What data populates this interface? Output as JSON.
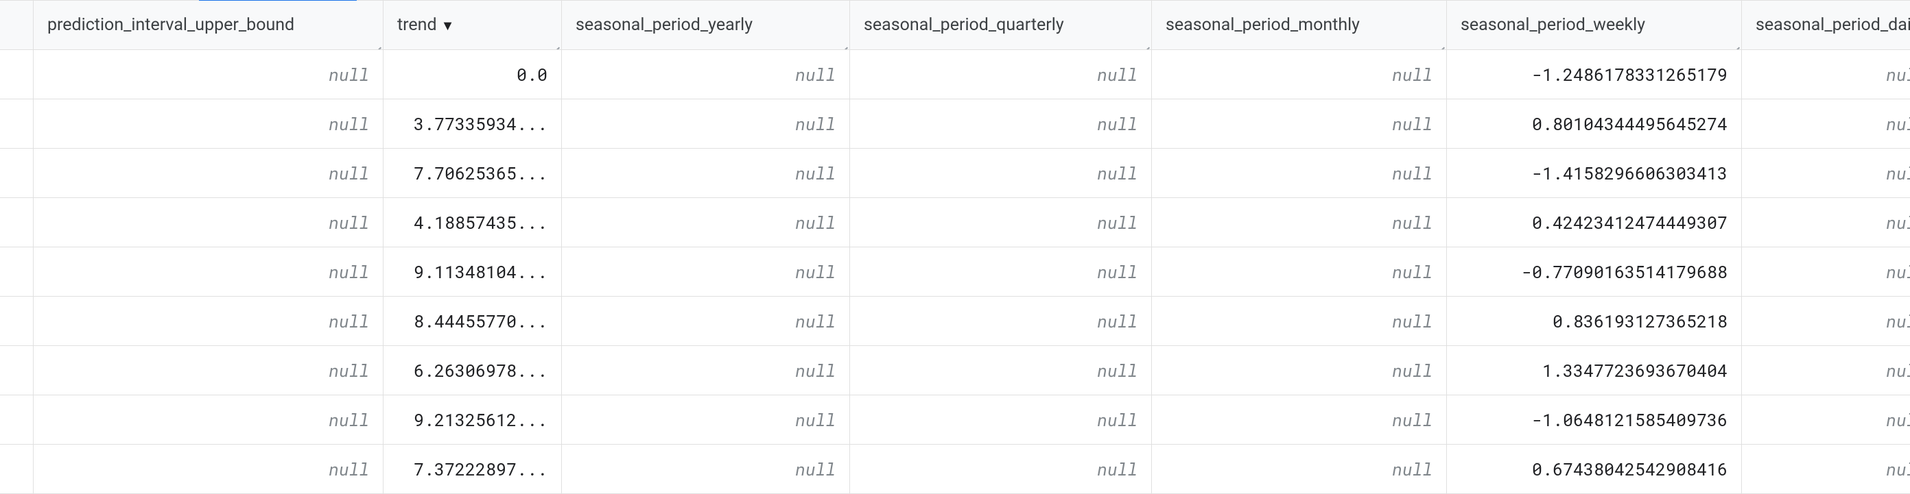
{
  "null_label": "null",
  "columns": [
    {
      "name": "prediction_interval_upper_bound",
      "sorted": false
    },
    {
      "name": "trend",
      "sorted": true
    },
    {
      "name": "seasonal_period_yearly",
      "sorted": false
    },
    {
      "name": "seasonal_period_quarterly",
      "sorted": false
    },
    {
      "name": "seasonal_period_monthly",
      "sorted": false
    },
    {
      "name": "seasonal_period_weekly",
      "sorted": false
    },
    {
      "name": "seasonal_period_daily",
      "sorted": false
    }
  ],
  "rows": [
    {
      "prediction_interval_upper_bound": null,
      "trend": "0.0",
      "seasonal_period_yearly": null,
      "seasonal_period_quarterly": null,
      "seasonal_period_monthly": null,
      "seasonal_period_weekly": "-1.2486178331265179",
      "seasonal_period_daily": null
    },
    {
      "prediction_interval_upper_bound": null,
      "trend": "3.77335934...",
      "seasonal_period_yearly": null,
      "seasonal_period_quarterly": null,
      "seasonal_period_monthly": null,
      "seasonal_period_weekly": "0.80104344495645274",
      "seasonal_period_daily": null
    },
    {
      "prediction_interval_upper_bound": null,
      "trend": "7.70625365...",
      "seasonal_period_yearly": null,
      "seasonal_period_quarterly": null,
      "seasonal_period_monthly": null,
      "seasonal_period_weekly": "-1.4158296606303413",
      "seasonal_period_daily": null
    },
    {
      "prediction_interval_upper_bound": null,
      "trend": "4.18857435...",
      "seasonal_period_yearly": null,
      "seasonal_period_quarterly": null,
      "seasonal_period_monthly": null,
      "seasonal_period_weekly": "0.42423412474449307",
      "seasonal_period_daily": null
    },
    {
      "prediction_interval_upper_bound": null,
      "trend": "9.11348104...",
      "seasonal_period_yearly": null,
      "seasonal_period_quarterly": null,
      "seasonal_period_monthly": null,
      "seasonal_period_weekly": "-0.77090163514179688",
      "seasonal_period_daily": null
    },
    {
      "prediction_interval_upper_bound": null,
      "trend": "8.44455770...",
      "seasonal_period_yearly": null,
      "seasonal_period_quarterly": null,
      "seasonal_period_monthly": null,
      "seasonal_period_weekly": "0.836193127365218",
      "seasonal_period_daily": null
    },
    {
      "prediction_interval_upper_bound": null,
      "trend": "6.26306978...",
      "seasonal_period_yearly": null,
      "seasonal_period_quarterly": null,
      "seasonal_period_monthly": null,
      "seasonal_period_weekly": "1.3347723693670404",
      "seasonal_period_daily": null
    },
    {
      "prediction_interval_upper_bound": null,
      "trend": "9.21325612...",
      "seasonal_period_yearly": null,
      "seasonal_period_quarterly": null,
      "seasonal_period_monthly": null,
      "seasonal_period_weekly": "-1.0648121585409736",
      "seasonal_period_daily": null
    },
    {
      "prediction_interval_upper_bound": null,
      "trend": "7.37222897...",
      "seasonal_period_yearly": null,
      "seasonal_period_quarterly": null,
      "seasonal_period_monthly": null,
      "seasonal_period_weekly": "0.67438042542908416",
      "seasonal_period_daily": null
    }
  ]
}
